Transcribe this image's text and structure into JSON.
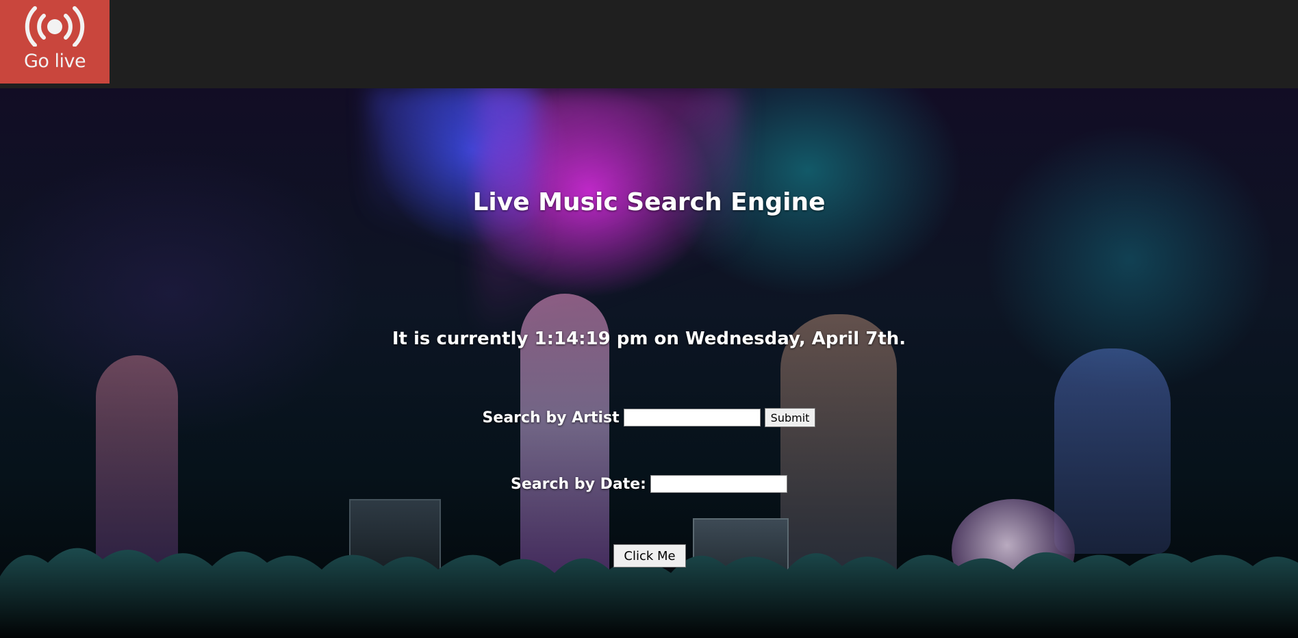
{
  "header": {
    "go_live_label": "Go live",
    "go_live_icon": "broadcast-icon",
    "bar_color": "#1f1f1f",
    "go_live_color": "#c9463d"
  },
  "main": {
    "title": "Live Music Search Engine",
    "clock_text": "It is currently 1:14:19 pm on Wednesday, April 7th.",
    "artist_search": {
      "label": "Search by Artist",
      "value": "",
      "submit_label": "Submit"
    },
    "date_search": {
      "label": "Search by Date:",
      "value": ""
    },
    "click_button_label": "Click Me"
  }
}
